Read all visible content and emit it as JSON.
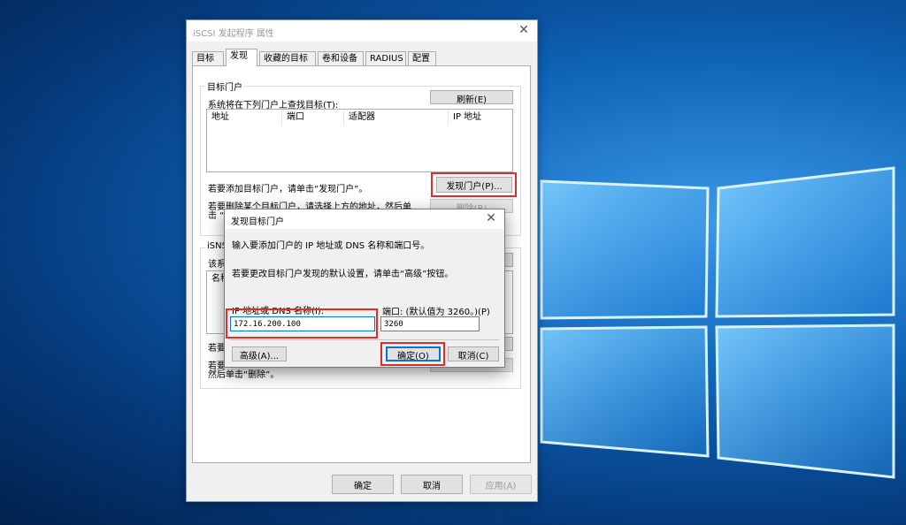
{
  "main_window": {
    "title": "iSCSI 发起程序 属性",
    "tabs": [
      {
        "label": "目标"
      },
      {
        "label": "发现"
      },
      {
        "label": "收藏的目标"
      },
      {
        "label": "卷和设备"
      },
      {
        "label": "RADIUS"
      },
      {
        "label": "配置"
      }
    ],
    "target_portals": {
      "group_label": "目标门户",
      "description": "系统将在下列门户上查找目标(T):",
      "refresh_button": "刷新(E)",
      "columns": [
        "地址",
        "端口",
        "适配器",
        "IP 地址"
      ],
      "add_hint": "若要添加目标门户，请单击“发现门户”。",
      "discover_button": "发现门户(P)...",
      "remove_hint_line1": "若要删除某个目标门户，请选择上方的地址，然后单",
      "remove_hint_line2": "击 “",
      "remove_button": "删除(R)"
    },
    "isns": {
      "group_label": "iSNS",
      "desc_partial": "该系",
      "column_partial": "名称",
      "add_partial": "若要",
      "remove_partial": "若要",
      "remove_line2": "然后单击“删除”。"
    },
    "footer": {
      "ok": "确定",
      "cancel": "取消",
      "apply": "应用(A)"
    }
  },
  "dialog": {
    "title": "发现目标门户",
    "instruction": "输入要添加门户的 IP 地址或 DNS 名称和端口号。",
    "advanced_hint": "若要更改目标门户发现的默认设置，请单击“高级”按钮。",
    "ip_label": "IP 地址或 DNS 名称(I):",
    "ip_value": "172.16.200.100",
    "port_label": "端口: (默认值为 3260。)(P)",
    "port_value": "3260",
    "advanced_button": "高级(A)...",
    "ok_button": "确定(O)",
    "cancel_button": "取消(C)"
  },
  "colors": {
    "highlight": "#e32b2b",
    "focus": "#0078d7",
    "desktop": "#0e63b6"
  }
}
